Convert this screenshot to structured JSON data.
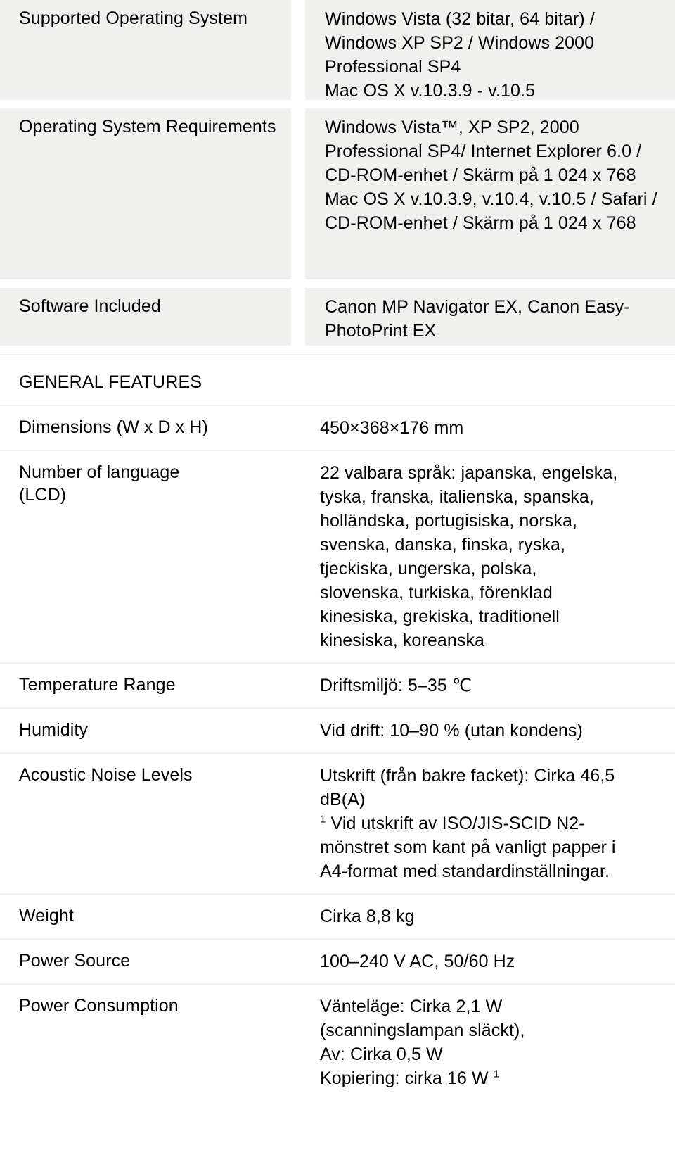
{
  "document": {
    "section_heading": "GENERAL FEATURES"
  },
  "shaded_rows": [
    {
      "label": "Supported Operating System",
      "value": "Windows Vista (32 bitar, 64 bitar) / Windows XP SP2 / Windows 2000 Professional SP4\nMac OS X v.10.3.9 - v.10.5"
    },
    {
      "label": "Operating System Requirements",
      "value": "Windows Vista™, XP SP2, 2000 Professional SP4/ Internet Explorer 6.0 / CD-ROM-enhet / Skärm på 1 024 x 768\nMac OS X v.10.3.9, v.10.4, v.10.5 / Safari / CD-ROM-enhet / Skärm på 1 024 x 768"
    },
    {
      "label": "Software Included",
      "value": "Canon MP Navigator EX, Canon Easy-PhotoPrint EX"
    }
  ],
  "plain_rows": [
    {
      "label": "Dimensions (W x D x H)",
      "value": "450×368×176 mm"
    },
    {
      "label": "Number of language (LCD)",
      "value": "22 valbara språk: japanska, engelska, tyska, franska, italienska, spanska, holländska, portugisiska, norska, svenska, danska, finska, ryska, tjeckiska, ungerska, polska, slovenska, turkiska, förenklad kinesiska, grekiska, traditionell kinesiska, koreanska"
    },
    {
      "label": "Temperature Range",
      "value": "Driftsmiljö: 5–35 ℃"
    },
    {
      "label": "Humidity",
      "value": "Vid drift: 10–90 % (utan kondens)"
    },
    {
      "label": "Acoustic Noise Levels",
      "value_line1": "Utskrift (från bakre facket): Cirka 46,5 dB(A)",
      "footnote_marker": "1",
      "value_line2": " Vid utskrift av ISO/JIS-SCID N2-mönstret som kant på vanligt papper i A4-format med standardinställningar."
    },
    {
      "label": "Weight",
      "value": "Cirka 8,8 kg"
    },
    {
      "label": "Power Source",
      "value": "100–240 V AC, 50/60 Hz"
    },
    {
      "label": "Power Consumption",
      "value_line1": "Vänteläge: Cirka 2,1 W (scanningslampan släckt),",
      "value_line2": "Av: Cirka 0,5 W",
      "value_line3": "Kopiering: cirka 16 W ",
      "footnote_marker": "1"
    }
  ]
}
